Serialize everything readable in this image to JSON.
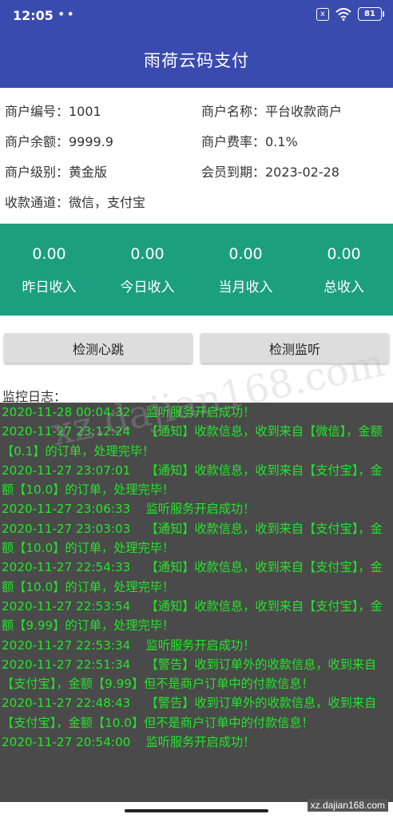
{
  "status_bar": {
    "time": "12:05",
    "dots": "••",
    "sim_label": "x",
    "battery": "81"
  },
  "app_bar": {
    "title": "雨荷云码支付"
  },
  "merchant": {
    "id": "商户编号：1001",
    "name": "商户名称：平台收款商户",
    "balance": "商户余额：9999.9",
    "fee": "商户费率：0.1%",
    "level": "商户级别：黄金版",
    "expiry": "会员到期：2023-02-28",
    "channels": "收款通道：微信，支付宝"
  },
  "stats": [
    {
      "value": "0.00",
      "label": "昨日收入"
    },
    {
      "value": "0.00",
      "label": "今日收入"
    },
    {
      "value": "0.00",
      "label": "当月收入"
    },
    {
      "value": "0.00",
      "label": "总收入"
    }
  ],
  "buttons": {
    "heartbeat": "检测心跳",
    "listener": "检测监听"
  },
  "log": {
    "title": "监控日志：",
    "entries": [
      "2020-11-28 00:04:32    监听服务开启成功！",
      "2020-11-27 23:12:24    【通知】收款信息，收到来自【微信】，金额【0.1】的订单，处理完毕！",
      "2020-11-27 23:07:01    【通知】收款信息，收到来自【支付宝】，金额【10.0】的订单，处理完毕！",
      "2020-11-27 23:06:33    监听服务开启成功！",
      "2020-11-27 23:03:03    【通知】收款信息，收到来自【支付宝】，金额【10.0】的订单，处理完毕！",
      "2020-11-27 22:54:33    【通知】收款信息，收到来自【支付宝】，金额【10.0】的订单，处理完毕！",
      "2020-11-27 22:53:54    【通知】收款信息，收到来自【支付宝】，金额【9.99】的订单，处理完毕！",
      "2020-11-27 22:53:34    监听服务开启成功！",
      "2020-11-27 22:51:34    【警告】收到订单外的收款信息，收到来自【支付宝】，金额【9.99】但不是商户订单中的付款信息！",
      "2020-11-27 22:48:43    【警告】收到订单外的收款信息，收到来自【支付宝】，金额【10.0】但不是商户订单中的付款信息！",
      "2020-11-27 20:54:00    监听服务开启成功！"
    ]
  },
  "watermark": {
    "center": "xz.dajian168.com",
    "corner": "xz.dajian168.com"
  },
  "colors": {
    "primary": "#3a4bb0",
    "stats_bg": "#1b9f7f",
    "log_bg": "#4a4a4a",
    "log_text": "#22e52a"
  }
}
